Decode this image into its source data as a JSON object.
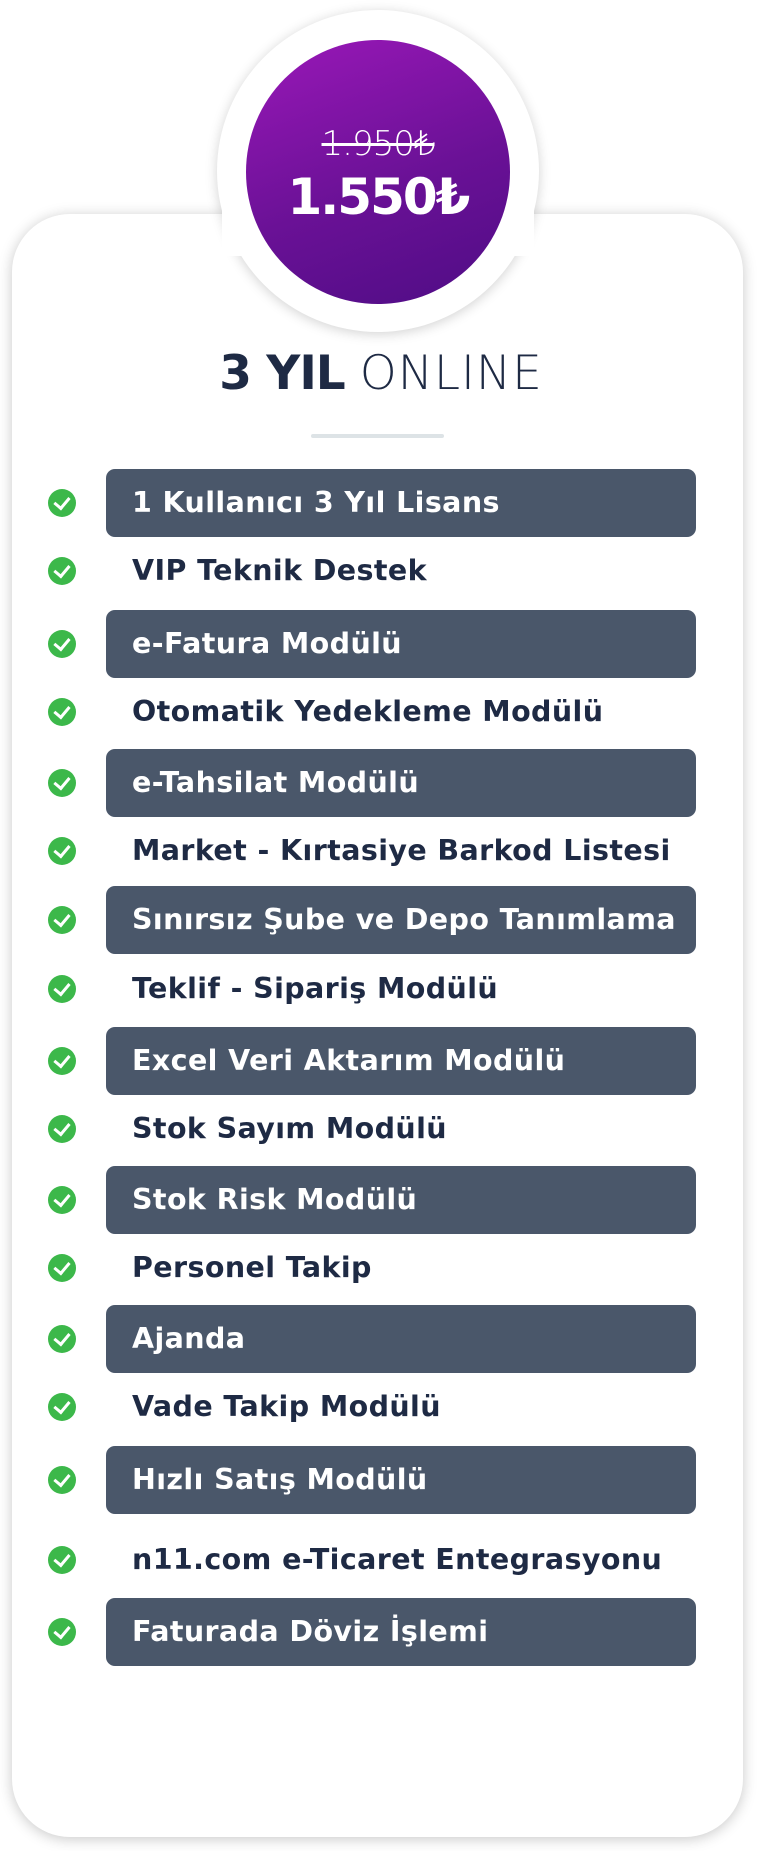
{
  "price": {
    "old": "1.950₺",
    "current": "1.550₺"
  },
  "plan": {
    "title_strong": "3 YIL",
    "title_light": "ONLINE"
  },
  "features": [
    {
      "label": "1 Kullanıcı 3 Yıl Lisans",
      "highlighted": true
    },
    {
      "label": "VIP Teknik Destek",
      "highlighted": false
    },
    {
      "label": "e-Fatura Modülü",
      "highlighted": true
    },
    {
      "label": "Otomatik Yedekleme Modülü",
      "highlighted": false
    },
    {
      "label": "e-Tahsilat Modülü",
      "highlighted": true
    },
    {
      "label": "Market - Kırtasiye Barkod Listesi",
      "highlighted": false
    },
    {
      "label": "Sınırsız Şube ve Depo Tanımlama",
      "highlighted": true
    },
    {
      "label": "Teklif - Sipariş Modülü",
      "highlighted": false
    },
    {
      "label": "Excel Veri Aktarım Modülü",
      "highlighted": true
    },
    {
      "label": "Stok Sayım Modülü",
      "highlighted": false
    },
    {
      "label": "Stok Risk Modülü",
      "highlighted": true
    },
    {
      "label": "Personel Takip",
      "highlighted": false
    },
    {
      "label": "Ajanda",
      "highlighted": true
    },
    {
      "label": "Vade Takip Modülü",
      "highlighted": false
    },
    {
      "label": "Hızlı Satış Modülü",
      "highlighted": true
    },
    {
      "label": "n11.com e-Ticaret Entegrasyonu",
      "highlighted": false
    },
    {
      "label": "Faturada Döviz İşlemi",
      "highlighted": true
    }
  ],
  "colors": {
    "price_gradient": [
      "#9a18b8",
      "#4f0c85"
    ],
    "bar": "#4a576a",
    "check": "#3cb84a",
    "text": "#1e2a44"
  },
  "icons": {
    "feature_check": "check-circle-icon"
  }
}
